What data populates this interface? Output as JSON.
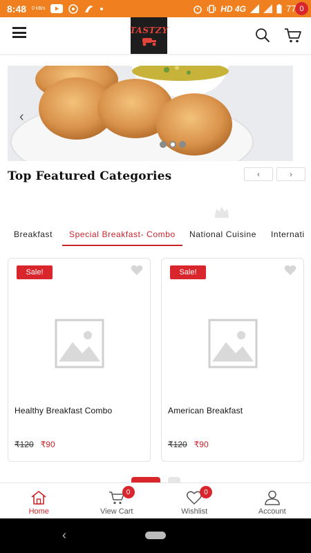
{
  "status_bar": {
    "time": "8:48",
    "data_speed": "0 kB/s",
    "network": "HD 4G",
    "battery": "77%"
  },
  "header": {
    "logo_text": "TASTZY",
    "cart_count": "0"
  },
  "banner": {
    "prev_arrow": "‹",
    "dots": 3,
    "active_dot": 2
  },
  "section": {
    "title": "Top Featured Categories",
    "prev": "‹",
    "next": "›"
  },
  "tabs": [
    {
      "label": "Breakfast",
      "active": false
    },
    {
      "label": "Special Breakfast- Combo",
      "active": true
    },
    {
      "label": "National Cuisine",
      "active": false
    },
    {
      "label": "Internati",
      "active": false
    }
  ],
  "products": [
    {
      "badge": "Sale!",
      "name": "Healthy Breakfast Combo",
      "old_price": "₹120",
      "price": "₹90"
    },
    {
      "badge": "Sale!",
      "name": "American Breakfast",
      "old_price": "₹120",
      "price": "₹90"
    }
  ],
  "bottom_nav": [
    {
      "label": "Home",
      "icon": "home-icon",
      "active": true
    },
    {
      "label": "View Cart",
      "icon": "cart-icon",
      "badge": "0"
    },
    {
      "label": "Wishlist",
      "icon": "heart-icon",
      "badge": "0"
    },
    {
      "label": "Account",
      "icon": "user-icon"
    }
  ],
  "colors": {
    "status_bar": "#f0801f",
    "accent": "#c9232a",
    "badge": "#d9252c"
  }
}
